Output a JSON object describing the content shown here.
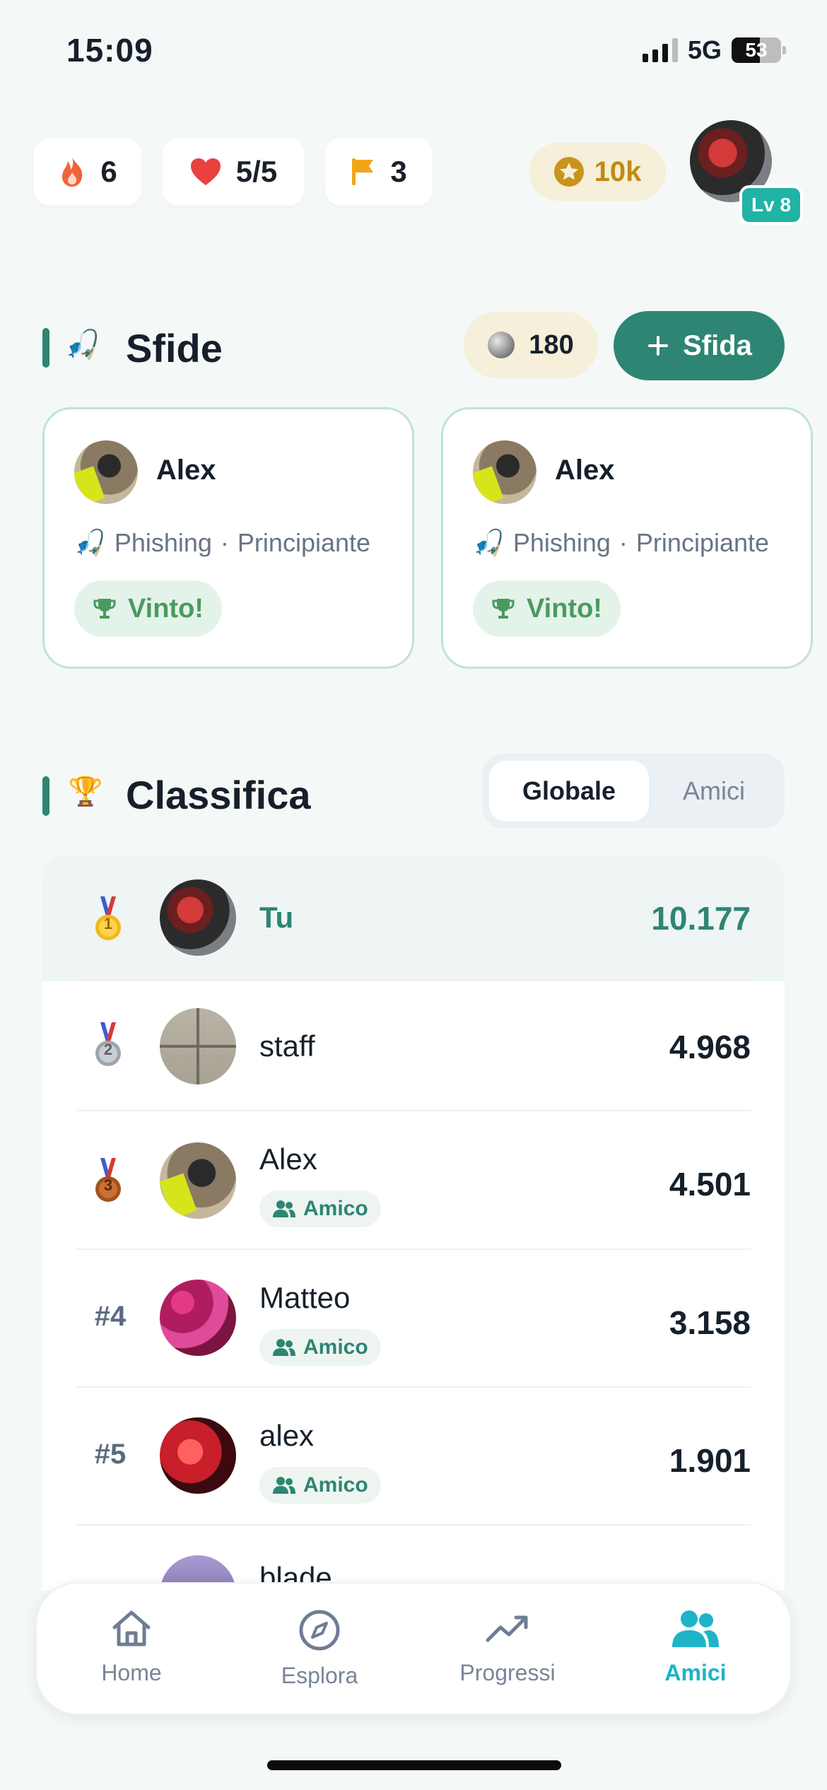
{
  "status_bar": {
    "time": "15:09",
    "network": "5G",
    "battery": "53"
  },
  "top_stats": {
    "streak": "6",
    "lives": "5/5",
    "flags": "3",
    "coins": "10k",
    "level": "Lv 8"
  },
  "challenges": {
    "title": "Sfide",
    "emoji": "🎣",
    "stones": "180",
    "new_button": "Sfida",
    "cards": [
      {
        "name": "Alex",
        "topic": "Phishing",
        "separator": "·",
        "level": "Principiante",
        "status": "Vinto!"
      },
      {
        "name": "Alex",
        "topic": "Phishing",
        "separator": "·",
        "level": "Principiante",
        "status": "Vinto!"
      }
    ]
  },
  "leaderboard": {
    "title": "Classifica",
    "emoji": "🏆",
    "tabs": {
      "global": "Globale",
      "friends": "Amici"
    },
    "friend_tag": "Amico",
    "rows": [
      {
        "rank": "1",
        "name": "Tu",
        "score": "10.177"
      },
      {
        "rank": "2",
        "name": "staff",
        "score": "4.968"
      },
      {
        "rank": "3",
        "name": "Alex",
        "score": "4.501",
        "friend": true
      },
      {
        "rank": "#4",
        "name": "Matteo",
        "score": "3.158",
        "friend": true
      },
      {
        "rank": "#5",
        "name": "alex",
        "score": "1.901",
        "friend": true
      },
      {
        "rank": "",
        "name": "blade",
        "score": ""
      }
    ]
  },
  "nav": {
    "home": "Home",
    "explore": "Esplora",
    "progress": "Progressi",
    "friends": "Amici"
  },
  "colors": {
    "accent": "#2e8573",
    "nav_active": "#1fb3c9",
    "win": "#4a9a5e",
    "gold": "#c08a14"
  }
}
